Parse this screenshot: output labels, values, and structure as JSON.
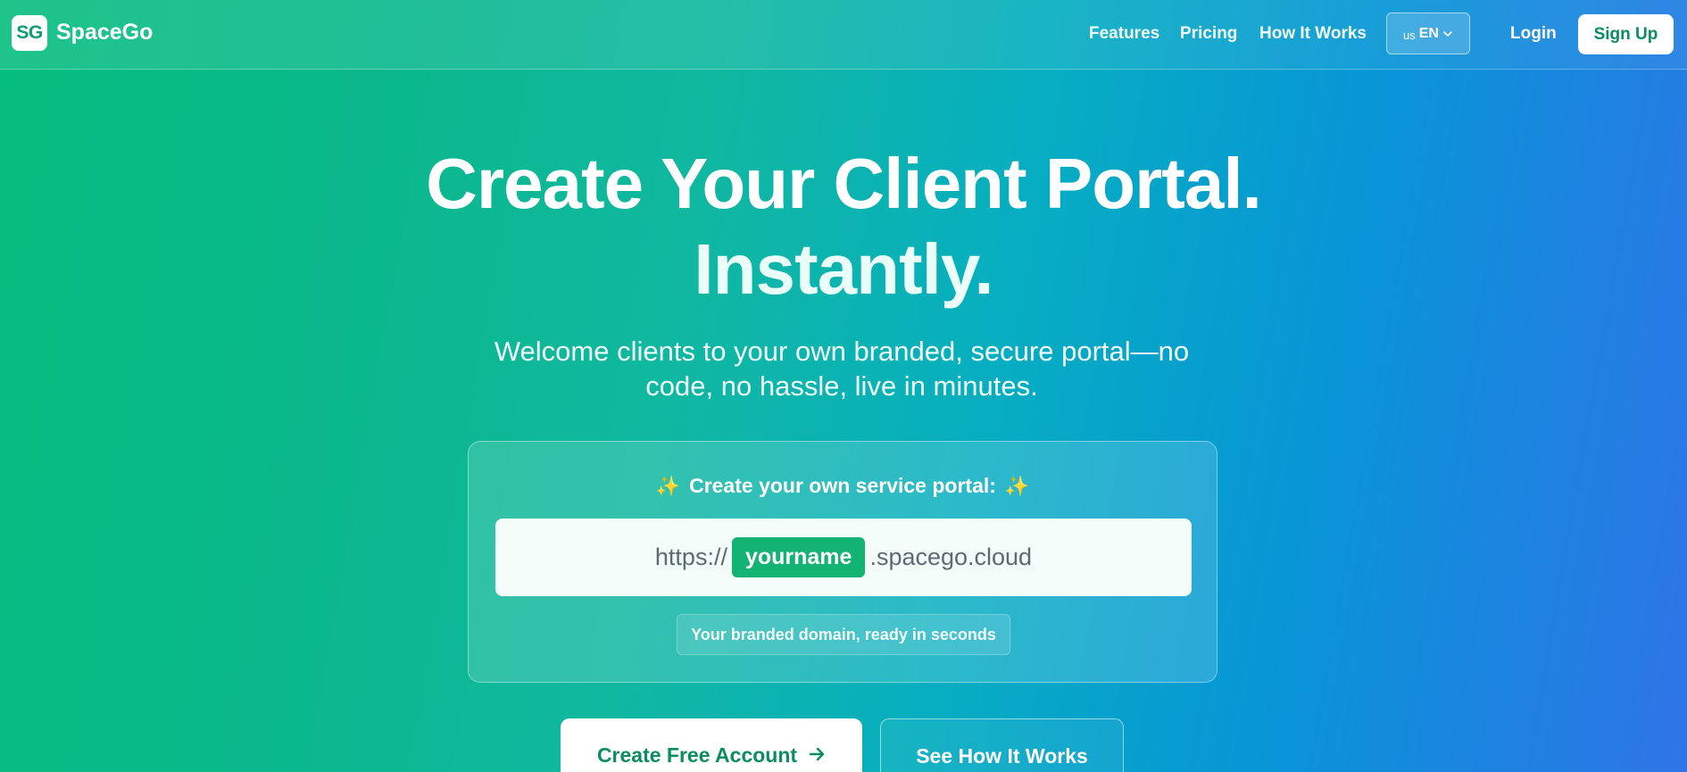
{
  "brand": {
    "logo_initials": "SG",
    "name": "SpaceGo"
  },
  "nav": {
    "links": [
      {
        "label": "Features"
      },
      {
        "label": "Pricing"
      },
      {
        "label": "How It Works"
      }
    ],
    "language": {
      "flag": "us",
      "code": "EN"
    },
    "login_label": "Login",
    "signup_label": "Sign Up"
  },
  "hero": {
    "title_line1": "Create Your Client Portal.",
    "title_line2": "Instantly.",
    "subtitle": "Welcome clients to your own branded, secure portal—no code, no hassle, live in minutes."
  },
  "portal_card": {
    "title": "Create your own service portal:",
    "url_prefix": "https://",
    "url_slug": "yourname",
    "url_suffix": ".spacego.cloud",
    "hint": "Your branded domain, ready in seconds"
  },
  "cta": {
    "primary_label": "Create Free Account",
    "secondary_label": "See How It Works"
  },
  "colors": {
    "brand_green": "#0a8d5f",
    "slug_green": "#13b374",
    "sparkle": "#ffcf4a"
  }
}
